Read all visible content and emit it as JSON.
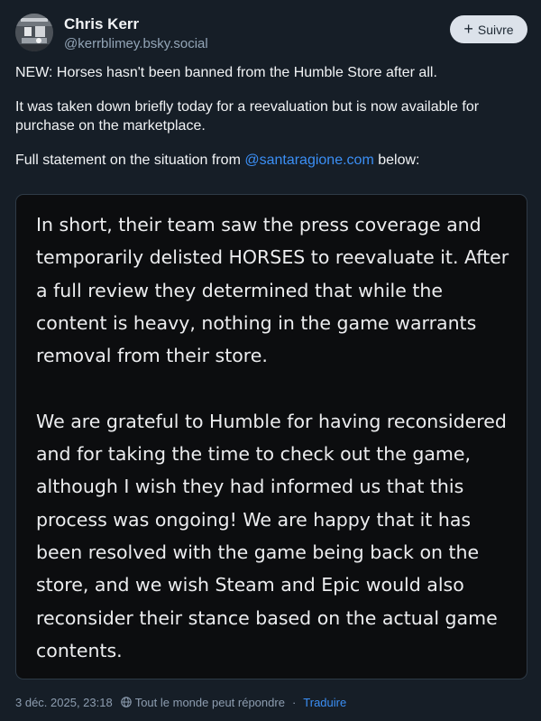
{
  "author": {
    "name": "Chris Kerr",
    "handle": "@kerrblimey.bsky.social",
    "avatar_icon": "avatar-photo"
  },
  "follow_button": {
    "icon": "plus-icon",
    "label": "Suivre"
  },
  "post": {
    "paragraph_1": "NEW: Horses hasn't been banned from the Humble Store after all.",
    "paragraph_2": "It was taken down briefly today for a reevaluation but is now available for purchase on the marketplace.",
    "paragraph_3_before": "Full statement on the situation from ",
    "mention": "@santaragione.com",
    "paragraph_3_after": " below:"
  },
  "embed": {
    "paragraph_1": "In short, their team saw the press coverage and temporarily delisted HORSES to reevaluate it. After a full review they determined that while the content is heavy, nothing in the game warrants removal from their store.",
    "paragraph_2": "We are grateful to Humble for having reconsidered and for taking the time to check out the game, although I wish they had informed us that this process was ongoing! We are happy that it has been resolved with the game being back on the store, and we wish Steam and Epic would also reconsider their stance based on the actual game contents."
  },
  "meta": {
    "timestamp": "3 déc. 2025, 23:18",
    "reply_setting_icon": "globe-icon",
    "reply_setting": "Tout le monde peut répondre",
    "separator": "·",
    "translate_link": "Traduire"
  },
  "colors": {
    "background": "#161e27",
    "link": "#3b8ff5",
    "embed_background": "#0c0d0f",
    "button_background": "#dce2ea"
  }
}
